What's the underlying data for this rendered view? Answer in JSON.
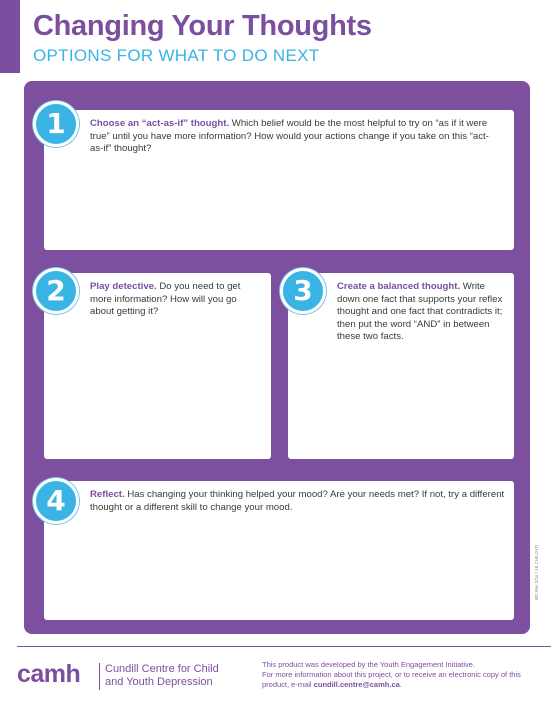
{
  "header": {
    "title": "Changing Your Thoughts",
    "subtitle": "OPTIONS FOR WHAT TO DO NEXT"
  },
  "steps": [
    {
      "number": "1",
      "lead": "Choose an “act-as-if” thought.",
      "text": " Which belief would be the most helpful to try on “as if it were true” until you have more information? How would your actions change if you take on this “act-as-if” thought?"
    },
    {
      "number": "2",
      "lead": "Play detective.",
      "text": " Do you need to get more information? How will you go about getting it?"
    },
    {
      "number": "3",
      "lead": "Create a balanced thought.",
      "text": " Write down one fact that supports your reflex thought and one fact that contradicts it; then put the word “AND” in between these two facts."
    },
    {
      "number": "4",
      "lead": "Reflect.",
      "text": " Has changing your thinking helped your mood? Are your needs met? If not, try a different thought or a different skill to change your mood."
    }
  ],
  "side_note": "BD Res 2/16 / 18 CHILDYD",
  "footer": {
    "logo": "camh",
    "centre_line1": "Cundill Centre for Child",
    "centre_line2": "and Youth Depression",
    "credit_line1": "This product was developed by the Youth Engagement Initiative.",
    "credit_line2": "For more information about this project, or to receive an electronic copy of this product, e-mail ",
    "credit_email": "cundill.centre@camh.ca",
    "credit_end": "."
  },
  "colors": {
    "purple": "#7b4fa0",
    "blue": "#3ab3e5"
  }
}
